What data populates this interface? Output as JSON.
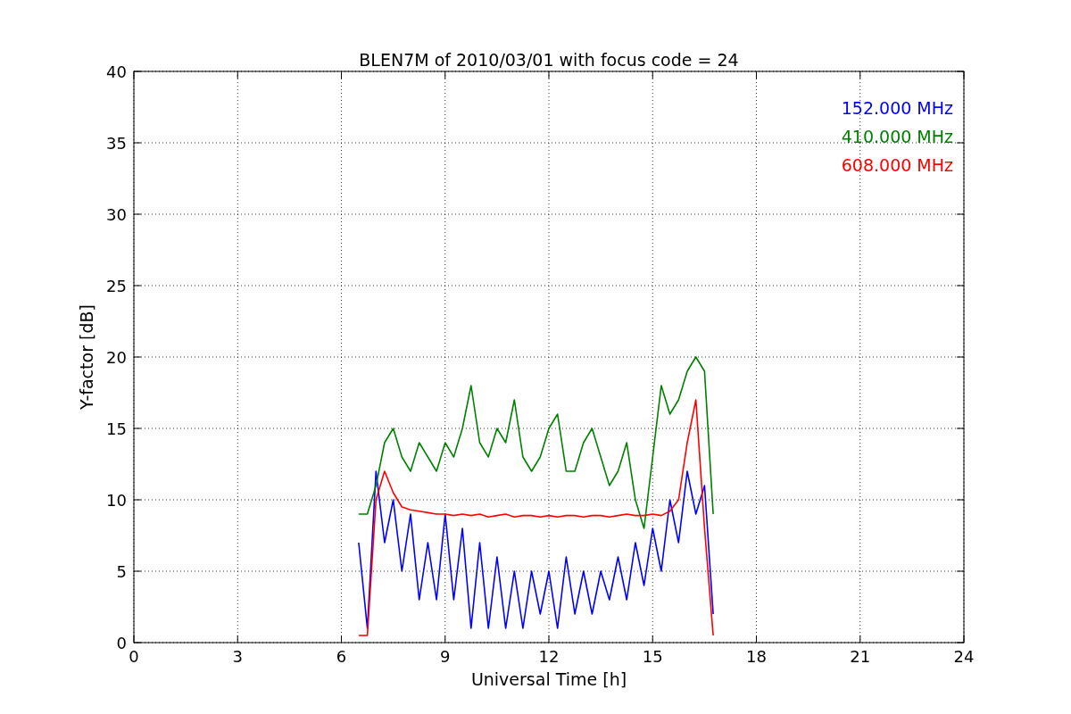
{
  "chart_data": {
    "type": "line",
    "title": "BLEN7M of 2010/03/01 with focus code = 24",
    "xlabel": "Universal Time [h]",
    "ylabel": "Y-factor [dB]",
    "x": [
      6.5,
      6.75,
      7.0,
      7.25,
      7.5,
      7.75,
      8.0,
      8.25,
      8.5,
      8.75,
      9.0,
      9.25,
      9.5,
      9.75,
      10.0,
      10.25,
      10.5,
      10.75,
      11.0,
      11.25,
      11.5,
      11.75,
      12.0,
      12.25,
      12.5,
      12.75,
      13.0,
      13.25,
      13.5,
      13.75,
      14.0,
      14.25,
      14.5,
      14.75,
      15.0,
      15.25,
      15.5,
      15.75,
      16.0,
      16.25,
      16.5,
      16.75
    ],
    "series": [
      {
        "name": "152.000 MHz",
        "color": "#0000ff",
        "values": [
          7,
          1,
          12,
          7,
          10,
          5,
          9,
          3,
          7,
          3,
          9,
          3,
          8,
          1,
          7,
          1,
          6,
          1,
          5,
          1,
          5,
          2,
          5,
          1,
          6,
          2,
          5,
          2,
          5,
          3,
          6,
          3,
          7,
          4,
          8,
          5,
          10,
          7,
          12,
          9,
          11,
          2
        ]
      },
      {
        "name": "410.000 MHz",
        "color": "#008000",
        "values": [
          9,
          9,
          11,
          14,
          15,
          13,
          12,
          14,
          13,
          12,
          14,
          13,
          15,
          18,
          14,
          13,
          15,
          14,
          17,
          13,
          12,
          13,
          15,
          16,
          12,
          12,
          14,
          15,
          13,
          11,
          12,
          14,
          10,
          8,
          13,
          18,
          16,
          17,
          19,
          20,
          19,
          9
        ]
      },
      {
        "name": "608.000 MHz",
        "color": "#ff0000",
        "values": [
          0.5,
          0.5,
          10,
          12,
          10.5,
          9.5,
          9.3,
          9.2,
          9.1,
          9,
          9,
          8.9,
          9,
          8.9,
          9,
          8.8,
          8.9,
          9,
          8.8,
          8.9,
          8.9,
          8.8,
          8.9,
          8.8,
          8.9,
          8.9,
          8.8,
          8.9,
          8.9,
          8.8,
          8.9,
          9,
          8.9,
          8.9,
          9,
          8.9,
          9.2,
          10,
          14,
          17,
          8,
          0.5
        ]
      }
    ],
    "grid": true,
    "xlim": [
      0,
      24
    ],
    "ylim": [
      0,
      40
    ],
    "xticks": [
      0,
      3,
      6,
      9,
      12,
      15,
      18,
      21,
      24
    ],
    "yticks": [
      0,
      5,
      10,
      15,
      20,
      25,
      30,
      35,
      40
    ]
  }
}
